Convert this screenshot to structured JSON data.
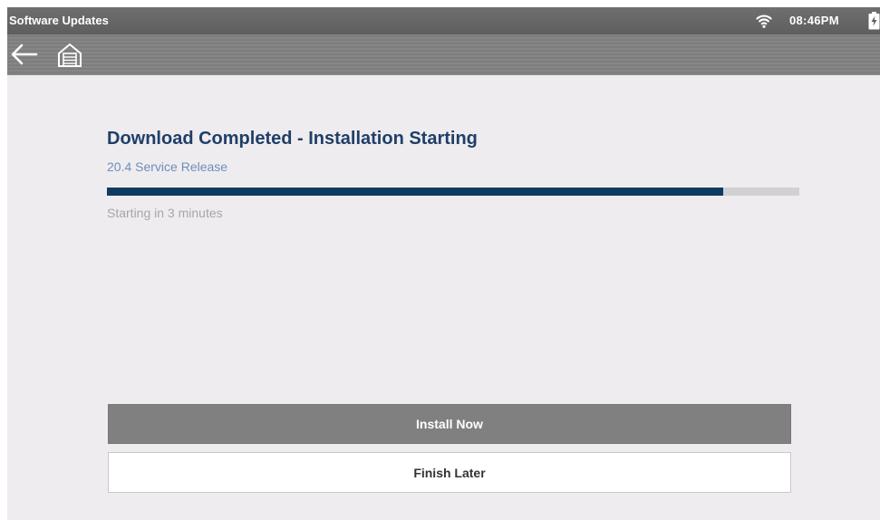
{
  "status_bar": {
    "title": "Software Updates",
    "time": "08:46PM",
    "icons": [
      "wifi-icon",
      "battery-charging-icon"
    ]
  },
  "nav_bar": {
    "icons": [
      "back-arrow-icon",
      "home-icon"
    ]
  },
  "main": {
    "heading": "Download Completed - Installation Starting",
    "release_name": "20.4 Service Release",
    "progress_percent": 89,
    "progress_caption": "Starting in 3 minutes"
  },
  "actions": {
    "install_label": "Install Now",
    "finish_label": "Finish Later"
  },
  "colors": {
    "heading": "#1f3f68",
    "progress_fill": "#0f3b63",
    "progress_track": "#d1d0d2",
    "primary_button": "#808080",
    "background": "#efecef"
  }
}
